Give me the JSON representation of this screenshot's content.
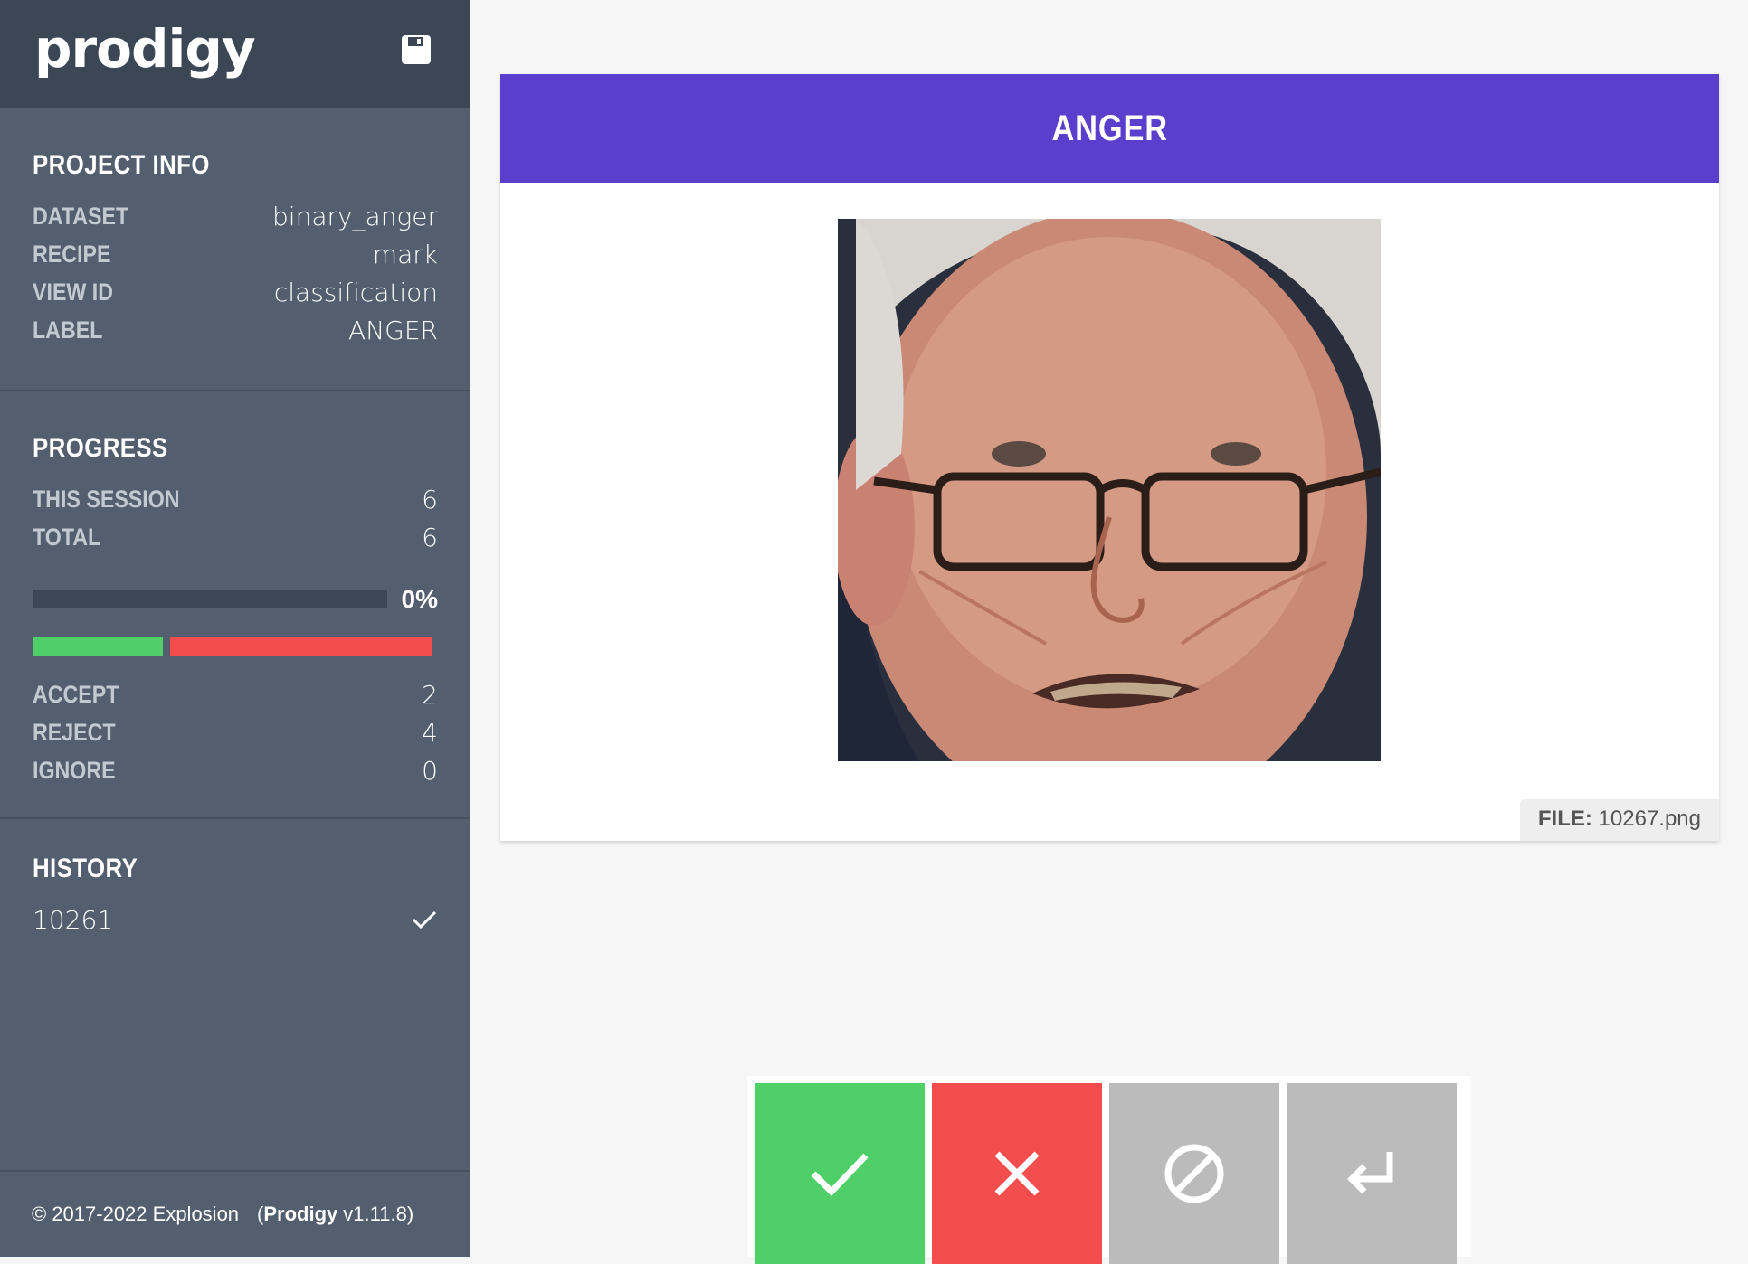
{
  "sidebar": {
    "logo": "prodigy",
    "project_info": {
      "title": "PROJECT INFO",
      "rows": [
        {
          "key": "DATASET",
          "value": "binary_anger"
        },
        {
          "key": "RECIPE",
          "value": "mark"
        },
        {
          "key": "VIEW ID",
          "value": "classification"
        },
        {
          "key": "LABEL",
          "value": "ANGER"
        }
      ]
    },
    "progress": {
      "title": "PROGRESS",
      "rows": [
        {
          "key": "THIS SESSION",
          "value": "6"
        },
        {
          "key": "TOTAL",
          "value": "6"
        }
      ],
      "percent_label": "0%",
      "percent": 0,
      "counts": [
        {
          "key": "ACCEPT",
          "value": "2"
        },
        {
          "key": "REJECT",
          "value": "4"
        },
        {
          "key": "IGNORE",
          "value": "0"
        }
      ],
      "accept_color": "#4fcf68",
      "reject_color": "#f44d4d"
    },
    "history": {
      "title": "HISTORY",
      "items": [
        {
          "id": "10261",
          "status_icon": "check-icon"
        }
      ]
    },
    "footer": {
      "copyright": "© 2017-2022 Explosion",
      "product": "Prodigy",
      "version": "v1.11.8"
    }
  },
  "card": {
    "label": "ANGER",
    "header_color": "#5a3fcd",
    "meta_key": "FILE:",
    "meta_value": "10267.png"
  },
  "actions": [
    {
      "name": "accept",
      "icon": "check-icon"
    },
    {
      "name": "reject",
      "icon": "close-icon"
    },
    {
      "name": "ignore",
      "icon": "ignore-icon"
    },
    {
      "name": "undo",
      "icon": "undo-icon"
    }
  ]
}
